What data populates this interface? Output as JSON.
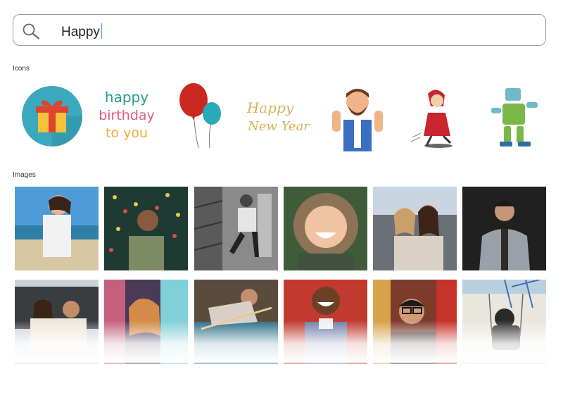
{
  "search": {
    "query": "Happy"
  },
  "sections": {
    "icons_title": "Icons",
    "images_title": "Images"
  },
  "icons": [
    {
      "name": "gift-icon"
    },
    {
      "name": "happy-birthday-lettering-icon",
      "lettering": [
        "happy",
        "birthday",
        "to you"
      ]
    },
    {
      "name": "balloons-icon"
    },
    {
      "name": "happy-new-year-lettering-icon",
      "lettering": [
        "Happy",
        "New Year"
      ]
    },
    {
      "name": "thumbs-up-man-icon"
    },
    {
      "name": "running-girl-icon"
    },
    {
      "name": "dancing-robot-icon"
    }
  ],
  "images": [
    {
      "name": "girl-on-beach-photo"
    },
    {
      "name": "man-in-confetti-photo"
    },
    {
      "name": "man-jumping-bw-photo"
    },
    {
      "name": "child-in-fur-hood-photo"
    },
    {
      "name": "two-friends-photo"
    },
    {
      "name": "man-in-jacket-photo"
    },
    {
      "name": "girls-in-car-trunk-photo"
    },
    {
      "name": "woman-neon-light-photo"
    },
    {
      "name": "man-pool-table-photo"
    },
    {
      "name": "smiling-woman-photo"
    },
    {
      "name": "man-with-glasses-photo"
    },
    {
      "name": "pug-on-swing-photo"
    }
  ],
  "colors": {
    "search_border": "#9a9a9a",
    "caret": "#4aa3df"
  }
}
